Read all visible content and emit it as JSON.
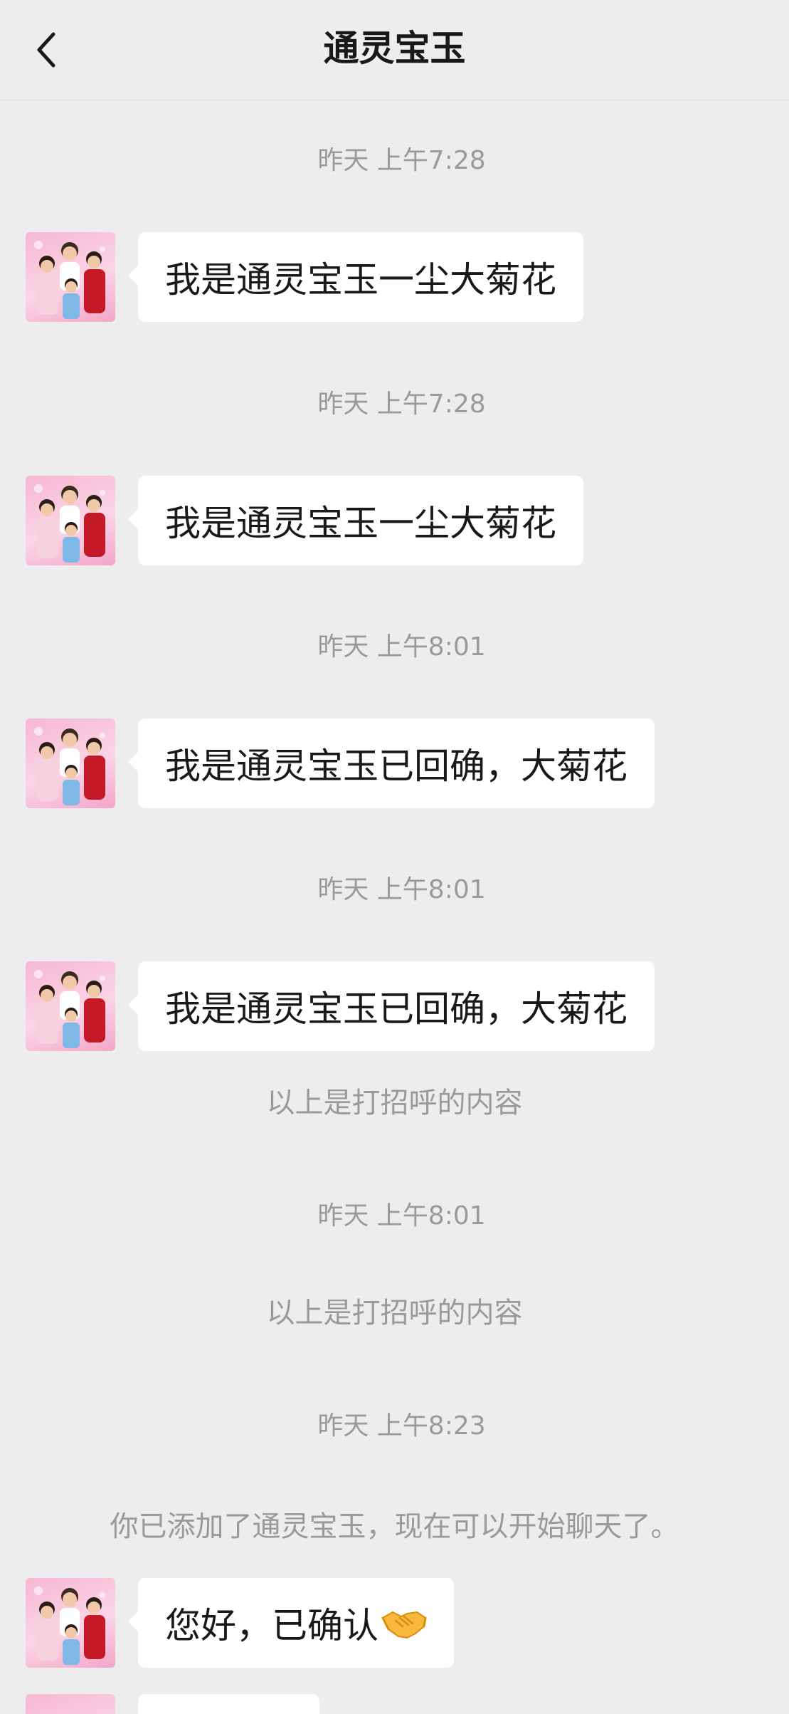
{
  "header": {
    "title": "通灵宝玉",
    "back_icon": "chevron-left-icon"
  },
  "messages": [
    {
      "timestamp": "昨天 上午7:28",
      "text": "我是通灵宝玉一尘大菊花"
    },
    {
      "timestamp": "昨天 上午7:28",
      "text": "我是通灵宝玉一尘大菊花"
    },
    {
      "timestamp": "昨天 上午8:01",
      "text": "我是通灵宝玉已回确，大菊花"
    },
    {
      "timestamp": "昨天 上午8:01",
      "text": "我是通灵宝玉已回确，大菊花"
    }
  ],
  "notices": {
    "greeting_1": "以上是打招呼的内容",
    "timestamp_5": "昨天 上午8:01",
    "greeting_2": "以上是打招呼的内容",
    "timestamp_6": "昨天 上午8:23",
    "added": "你已添加了通灵宝玉，现在可以开始聊天了。"
  },
  "last_message": {
    "text": "您好，已确认",
    "emoji": "handshake-icon"
  },
  "colors": {
    "background": "#ededed",
    "bubble": "#ffffff",
    "system_text": "#9a9a9a",
    "text": "#191919"
  }
}
